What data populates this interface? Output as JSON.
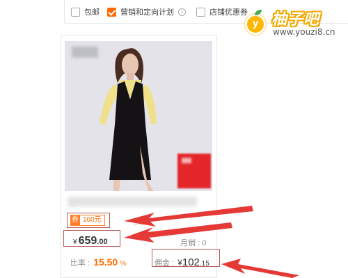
{
  "filters": [
    {
      "label": "包邮",
      "checked": false
    },
    {
      "label": "营销和定向计划",
      "checked": true
    },
    {
      "label": "店铺优惠券",
      "checked": false
    }
  ],
  "watermark": {
    "logo_letter": "y",
    "title": "柚子吧",
    "url": "www.youzi8.cn"
  },
  "product": {
    "title_ellipsis": "…",
    "coupon": {
      "tag": "券",
      "value": "100元"
    },
    "remaining": "余2",
    "price": {
      "currency": "¥",
      "integer": "659",
      "decimal": ".00"
    },
    "sales": {
      "label": "月销",
      "value": "0"
    },
    "commission_rate": {
      "label": "比率 :",
      "value": "15.50",
      "unit": "%"
    },
    "commission": {
      "label": "佣金 :",
      "currency": "¥",
      "integer": "102",
      "decimal": ".15"
    }
  },
  "colors": {
    "accent": "#ff6a00",
    "annotation_red": "#e53935",
    "badge_red": "#e4262a"
  }
}
